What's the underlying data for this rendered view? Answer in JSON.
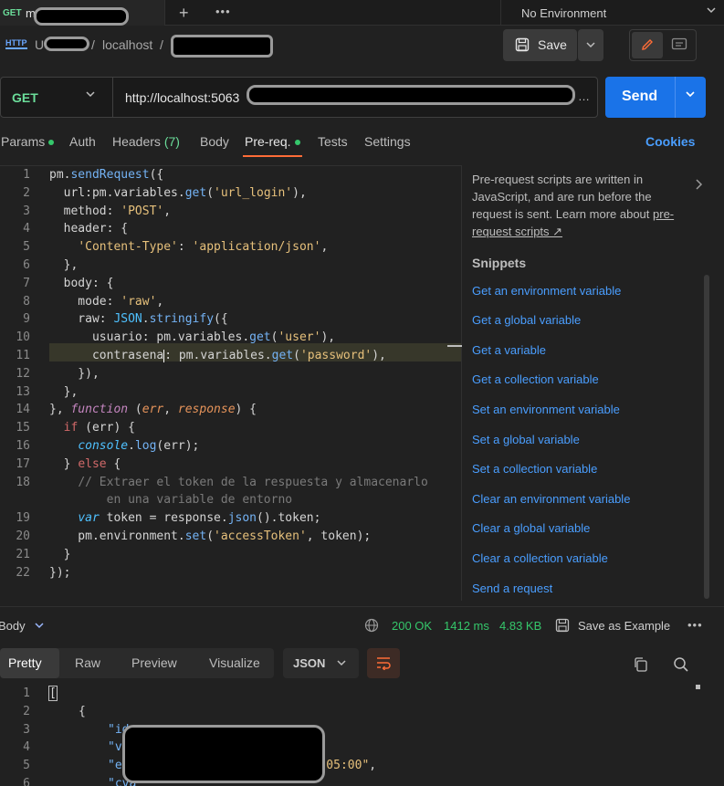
{
  "tab": {
    "method": "GET",
    "name": "m"
  },
  "environment": {
    "selected": "No Environment"
  },
  "breadcrumb": {
    "workspace": "U",
    "collection": "localhost",
    "request": ""
  },
  "header": {
    "save_label": "Save"
  },
  "url": {
    "method": "GET",
    "value": "http://localhost:5063"
  },
  "send_label": "Send",
  "request_tabs": {
    "params": "Params",
    "auth": "Auth",
    "headers": "Headers",
    "headers_count": "(7)",
    "body": "Body",
    "prereq": "Pre-req.",
    "tests": "Tests",
    "settings": "Settings",
    "cookies": "Cookies"
  },
  "editor": {
    "line_numbers": [
      "1",
      "2",
      "3",
      "4",
      "5",
      "6",
      "7",
      "8",
      "9",
      "10",
      "11",
      "12",
      "13",
      "14",
      "15",
      "16",
      "17",
      "18",
      "",
      "19",
      "20",
      "21",
      "22"
    ]
  },
  "side_panel": {
    "description": "Pre-request scripts are written in JavaScript, and are run before the request is sent. Learn more about",
    "learn_more_link": "pre-request scripts ↗",
    "snippets_title": "Snippets",
    "snippets": [
      "Get an environment variable",
      "Get a global variable",
      "Get a variable",
      "Get a collection variable",
      "Set an environment variable",
      "Set a global variable",
      "Set a collection variable",
      "Clear an environment variable",
      "Clear a global variable",
      "Clear a collection variable",
      "Send a request"
    ]
  },
  "response": {
    "section_label": "Body",
    "status": "200 OK",
    "time": "1412 ms",
    "size": "4.83 KB",
    "save_example": "Save as Example",
    "view_tabs": [
      "Pretty",
      "Raw",
      "Preview",
      "Visualize"
    ],
    "active_view": "Pretty",
    "format": "JSON",
    "line_numbers": [
      "1",
      "2",
      "3",
      "4",
      "5",
      "6"
    ]
  },
  "colors": {
    "accent_send": "#1a73e8",
    "get_method": "#6bdd9a",
    "active_tab_underline": "#ff6c37",
    "link_blue": "#4a9eff",
    "status_ok": "#35c76b"
  }
}
